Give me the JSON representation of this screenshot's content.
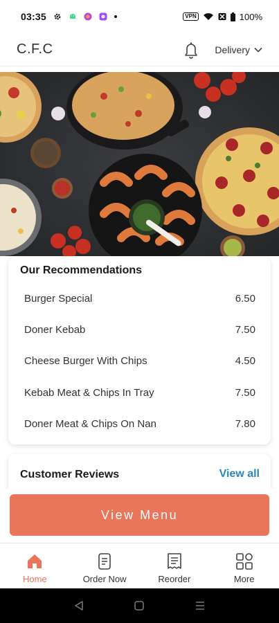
{
  "status_bar": {
    "time": "03:35",
    "vpn": "VPN",
    "battery": "100%"
  },
  "header": {
    "brand": "C.F.C",
    "delivery_label": "Delivery"
  },
  "recommendations": {
    "title": "Our Recommendations",
    "items": [
      {
        "name": "Burger Special",
        "price": "6.50"
      },
      {
        "name": "Doner Kebab",
        "price": "7.50"
      },
      {
        "name": "Cheese Burger With Chips",
        "price": "4.50"
      },
      {
        "name": "Kebab Meat & Chips In Tray",
        "price": "7.50"
      },
      {
        "name": "Doner Meat & Chips On Nan",
        "price": "7.80"
      }
    ]
  },
  "reviews": {
    "title": "Customer Reviews",
    "view_all": "View all"
  },
  "cta": {
    "label": "View Menu"
  },
  "bottom_nav": {
    "items": [
      {
        "label": "Home",
        "icon": "home-icon",
        "active": true
      },
      {
        "label": "Order Now",
        "icon": "phone-order-icon",
        "active": false
      },
      {
        "label": "Reorder",
        "icon": "receipt-icon",
        "active": false
      },
      {
        "label": "More",
        "icon": "grid-icon",
        "active": false
      }
    ]
  },
  "colors": {
    "accent": "#e9755a",
    "link": "#2b86b8",
    "hero_bg": "#2f3133"
  }
}
